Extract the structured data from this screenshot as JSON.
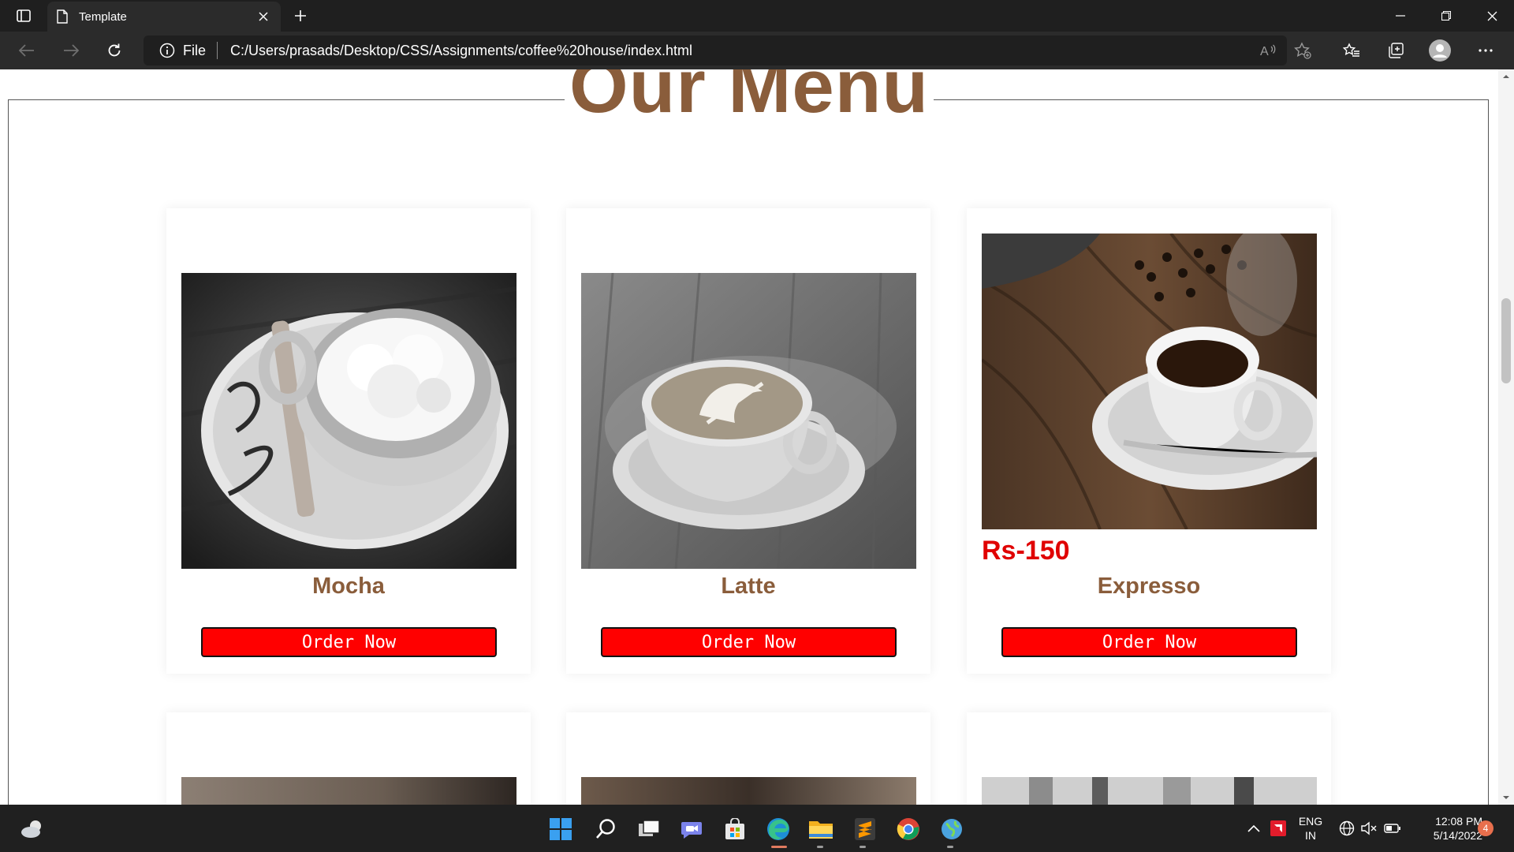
{
  "browser": {
    "tab_title": "Template",
    "url_scheme_label": "File",
    "url": "C:/Users/prasads/Desktop/CSS/Assignments/coffee%20house/index.html"
  },
  "page": {
    "heading": "Our Menu",
    "accent_color": "#8a5d3b",
    "button_color": "#ff0000",
    "cards": [
      {
        "name": "Mocha",
        "price": "",
        "button": "Order Now"
      },
      {
        "name": "Latte",
        "price": "",
        "button": "Order Now"
      },
      {
        "name": "Expresso",
        "price": "Rs-150",
        "button": "Order Now"
      }
    ]
  },
  "taskbar": {
    "language": "ENG",
    "region": "IN",
    "time": "12:08 PM",
    "date": "5/14/2022",
    "notifications": "4",
    "pinned_icons": [
      "start-icon",
      "search-icon",
      "task-view-icon",
      "teams-chat-icon",
      "store-icon",
      "edge-icon",
      "file-explorer-icon",
      "sublime-text-icon",
      "chrome-icon",
      "globe-app-icon"
    ]
  }
}
